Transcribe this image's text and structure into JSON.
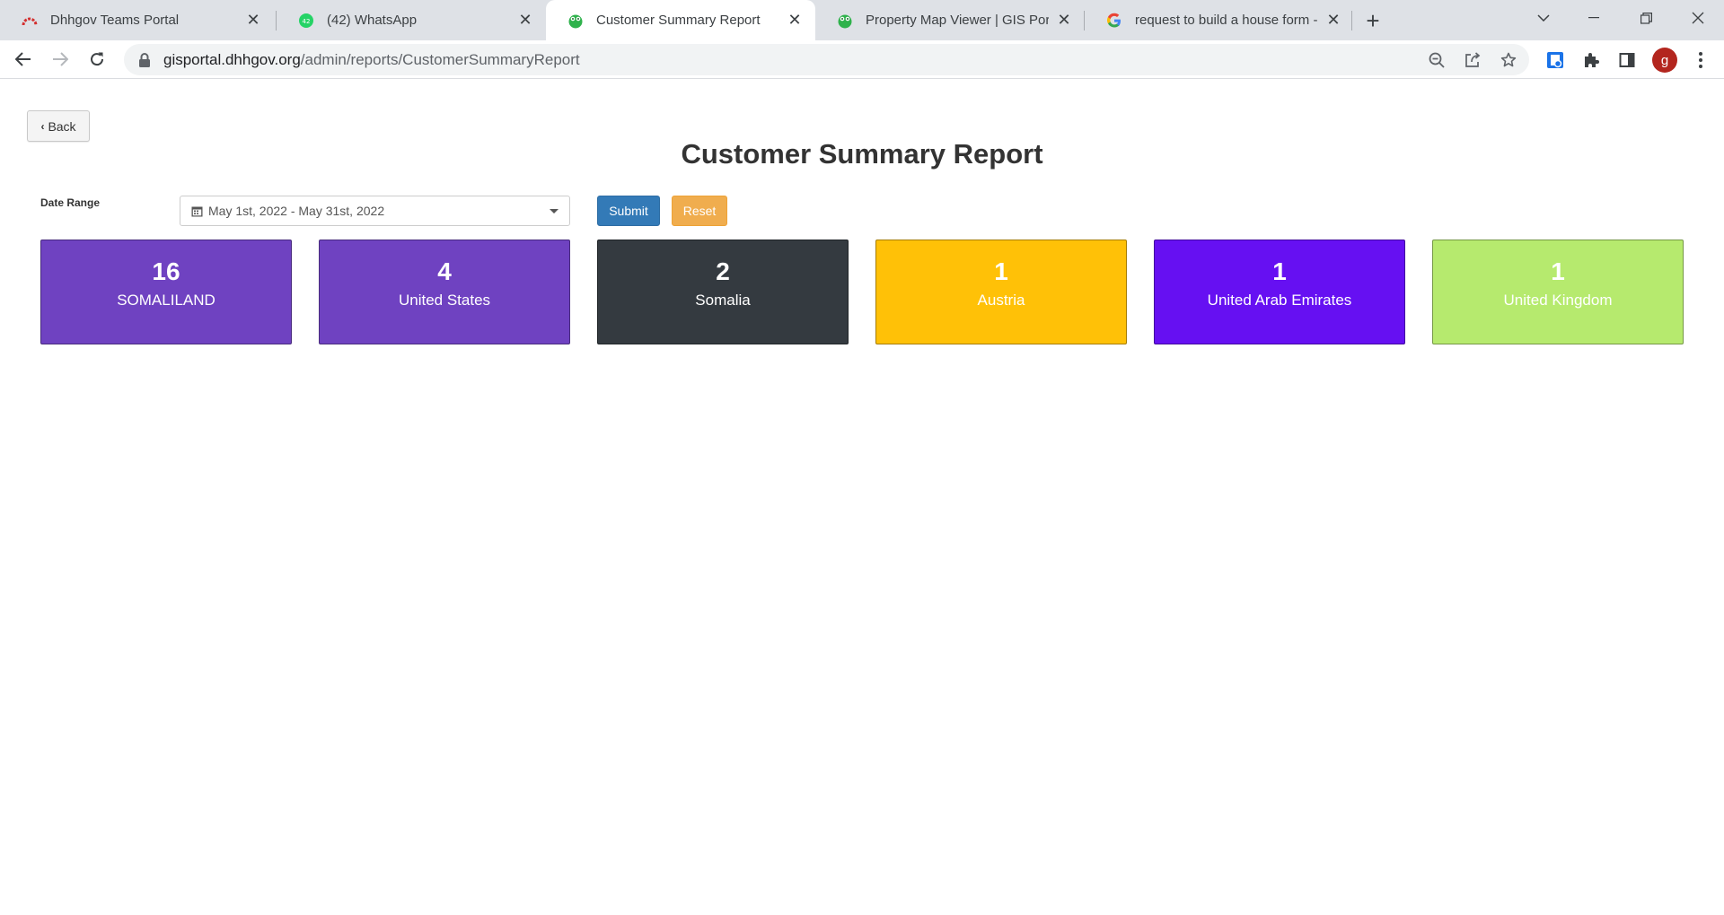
{
  "browser": {
    "tabs": [
      {
        "title": "Dhhgov Teams Portal",
        "active": false
      },
      {
        "title": "(42) WhatsApp",
        "active": false,
        "badge": "42"
      },
      {
        "title": "Customer Summary Report",
        "active": true
      },
      {
        "title": "Property Map Viewer | GIS Portal",
        "active": false
      },
      {
        "title": "request to build a house form - G",
        "active": false
      }
    ],
    "address": {
      "host": "gisportal.dhhgov.org",
      "path": "/admin/reports/CustomerSummaryReport"
    },
    "profile_initial": "g"
  },
  "page": {
    "back_label": "Back",
    "title": "Customer Summary Report",
    "filters": {
      "date_range_label": "Date Range",
      "date_range_value": "May 1st, 2022 - May 31st, 2022",
      "submit_label": "Submit",
      "reset_label": "Reset"
    },
    "cards": [
      {
        "count": "16",
        "country": "SOMALILAND",
        "color": "#6f42c1"
      },
      {
        "count": "4",
        "country": "United States",
        "color": "#6f42c1"
      },
      {
        "count": "2",
        "country": "Somalia",
        "color": "#343a40"
      },
      {
        "count": "1",
        "country": "Austria",
        "color": "#ffc107"
      },
      {
        "count": "1",
        "country": "United Arab Emirates",
        "color": "#6610f2"
      },
      {
        "count": "1",
        "country": "United Kingdom",
        "color": "#b6ea6e"
      }
    ]
  }
}
